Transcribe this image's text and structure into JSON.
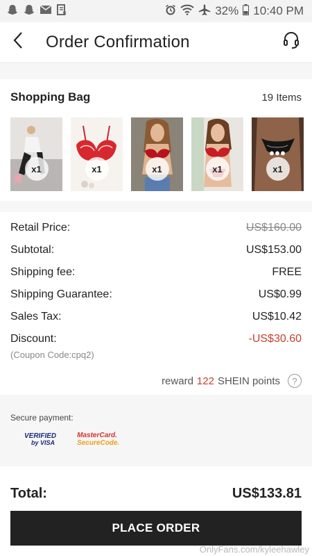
{
  "status_bar": {
    "battery": "32%",
    "time": "10:40 PM"
  },
  "header": {
    "title": "Order Confirmation"
  },
  "shopping_bag": {
    "title": "Shopping Bag",
    "count": "19 Items",
    "items": [
      {
        "qty": "x1"
      },
      {
        "qty": "x1"
      },
      {
        "qty": "x1"
      },
      {
        "qty": "x1"
      },
      {
        "qty": "x1",
        "more": "•••"
      }
    ]
  },
  "prices": {
    "retail_label": "Retail Price:",
    "retail_value": "US$160.00",
    "subtotal_label": "Subtotal:",
    "subtotal_value": "US$153.00",
    "shipping_label": "Shipping fee:",
    "shipping_value": "FREE",
    "guarantee_label": "Shipping Guarantee:",
    "guarantee_value": "US$0.99",
    "tax_label": "Sales Tax:",
    "tax_value": "US$10.42",
    "discount_label": "Discount:",
    "discount_value": "-US$30.60",
    "coupon": "(Coupon Code:cpq2)"
  },
  "reward": {
    "prefix": "reward",
    "points": "122",
    "suffix": "SHEIN points",
    "help": "?"
  },
  "secure": {
    "label": "Secure payment:",
    "visa_line1": "VERIFIED",
    "visa_line2": "by VISA",
    "mc_line1": "MasterCard.",
    "mc_line2": "SecureCode."
  },
  "total": {
    "label": "Total:",
    "value": "US$133.81"
  },
  "place_order": "PLACE ORDER",
  "watermark": "OnlyFans.com/kyleehawley",
  "colors": {
    "accent_red": "#c44130",
    "button_bg": "#222222"
  }
}
